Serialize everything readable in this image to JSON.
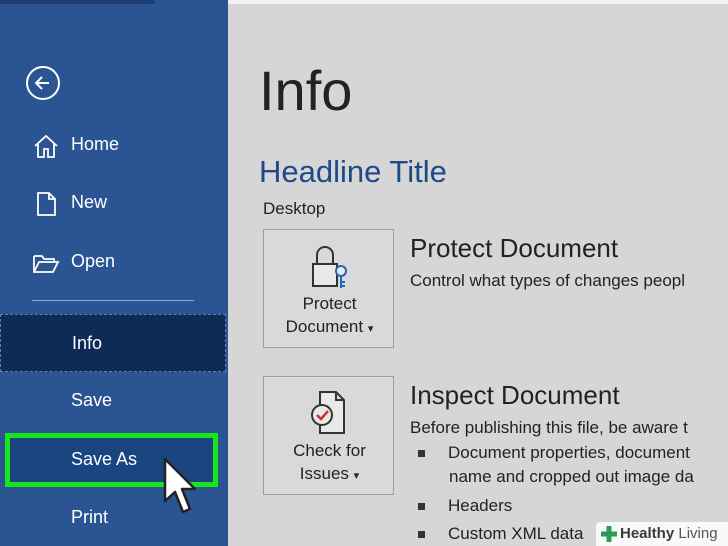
{
  "sidebar": {
    "items": [
      {
        "label": "Home",
        "icon": "home-icon"
      },
      {
        "label": "New",
        "icon": "new-document-icon"
      },
      {
        "label": "Open",
        "icon": "folder-open-icon"
      },
      {
        "label": "Info"
      },
      {
        "label": "Save"
      },
      {
        "label": "Save As"
      },
      {
        "label": "Print"
      }
    ],
    "selected": "Info",
    "highlighted": "Save As",
    "highlight_color": "#19e51e",
    "background_color": "#2b5592"
  },
  "main": {
    "title": "Info",
    "document_title": "Headline Title",
    "document_location": "Desktop",
    "sections": [
      {
        "button_label_line1": "Protect",
        "button_label_line2": "Document",
        "button_caret": "▾",
        "icon": "lock-key-icon",
        "title": "Protect Document",
        "description": "Control what types of changes peopl"
      },
      {
        "button_label_line1": "Check for",
        "button_label_line2": "Issues",
        "button_caret": "▾",
        "icon": "inspect-document-icon",
        "title": "Inspect Document",
        "description": "Before publishing this file, be aware t",
        "bullets": [
          "Document properties, document",
          "name and cropped out image da",
          "Headers",
          "Custom XML data"
        ]
      }
    ]
  },
  "watermark": {
    "brand_bold": "Healthy",
    "brand_light": "Living",
    "icon": "plus-icon",
    "color": "#2e9b52"
  }
}
